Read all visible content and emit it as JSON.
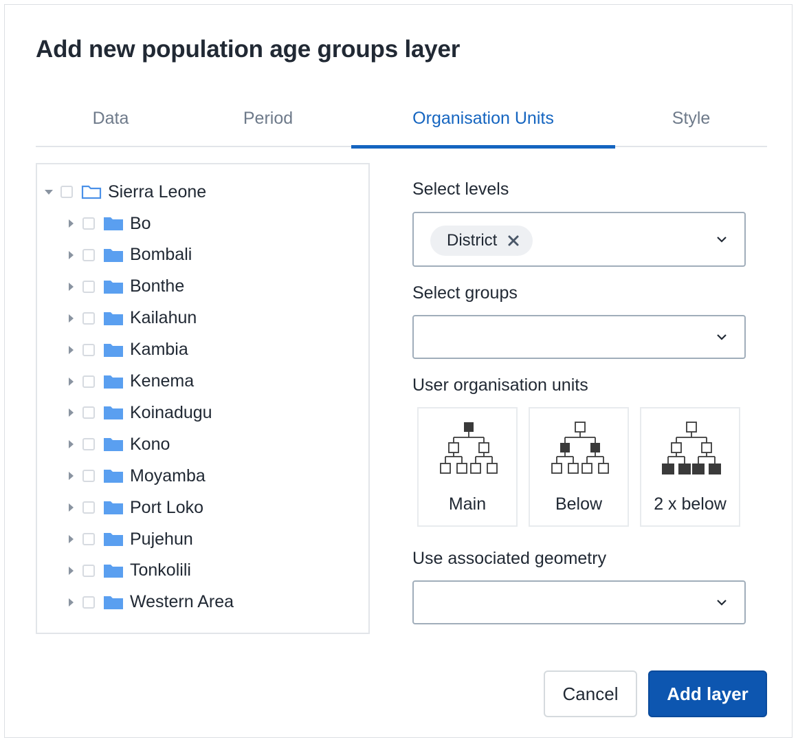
{
  "dialog": {
    "title": "Add new population age groups layer"
  },
  "tabs": [
    {
      "label": "Data"
    },
    {
      "label": "Period"
    },
    {
      "label": "Organisation Units"
    },
    {
      "label": "Style"
    }
  ],
  "active_tab": "Organisation Units",
  "tree": {
    "root": {
      "label": "Sierra Leone",
      "expanded": true,
      "checked": false
    },
    "children": [
      {
        "label": "Bo"
      },
      {
        "label": "Bombali"
      },
      {
        "label": "Bonthe"
      },
      {
        "label": "Kailahun"
      },
      {
        "label": "Kambia"
      },
      {
        "label": "Kenema"
      },
      {
        "label": "Koinadugu"
      },
      {
        "label": "Kono"
      },
      {
        "label": "Moyamba"
      },
      {
        "label": "Port Loko"
      },
      {
        "label": "Pujehun"
      },
      {
        "label": "Tonkolili"
      },
      {
        "label": "Western Area"
      }
    ]
  },
  "select_levels": {
    "label": "Select levels",
    "selected_chip": "District"
  },
  "select_groups": {
    "label": "Select groups",
    "value": ""
  },
  "user_org_units": {
    "label": "User organisation units",
    "options": [
      {
        "label": "Main"
      },
      {
        "label": "Below"
      },
      {
        "label": "2 x below"
      }
    ]
  },
  "associated_geometry": {
    "label": "Use associated geometry",
    "value": ""
  },
  "buttons": {
    "cancel": "Cancel",
    "add": "Add layer"
  },
  "colors": {
    "accent": "#1565c0",
    "primary_button": "#0d56b0",
    "folder": "#5a9ff0"
  }
}
